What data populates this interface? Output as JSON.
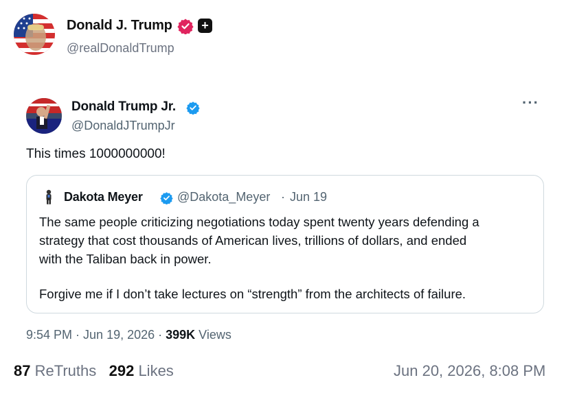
{
  "post": {
    "author_name": "Donald J. Trump",
    "author_handle": "@realDonaldTrump",
    "verified_icon": "verified-badge-icon",
    "plus_icon": "plus-icon",
    "plus_glyph": "+",
    "colors": {
      "badge": "#e0245e",
      "handle": "#6b7280"
    }
  },
  "tweet": {
    "author_name": "Donald Trump Jr.",
    "author_handle": "@DonaldJTrumpJr",
    "more_label": "···",
    "text": "This times 1000000000!",
    "time": "9:54 PM",
    "date": "Jun 19, 2026",
    "meta_sep": " · ",
    "views_count": "399K",
    "views_label": " Views",
    "colors": {
      "verified": "#1d9bf0",
      "secondary": "#536471",
      "border": "#cfd9de"
    }
  },
  "quote": {
    "author_name": "Dakota Meyer",
    "author_handle": "@Dakota_Meyer",
    "separator": "·",
    "date": "Jun 19",
    "lines": [
      "The same people criticizing negotiations today spent twenty years defending a",
      "strategy that cost thousands of American lives, trillions of dollars, and ended",
      "with the Taliban back in power.",
      "Forgive me if I don’t take lectures on “strength” from the architects of failure."
    ]
  },
  "stats": {
    "retruths_count": "87",
    "retruths_label": " ReTruths",
    "likes_count": "292",
    "likes_label": " Likes",
    "posted_at": "Jun 20, 2026, 8:08 PM"
  }
}
